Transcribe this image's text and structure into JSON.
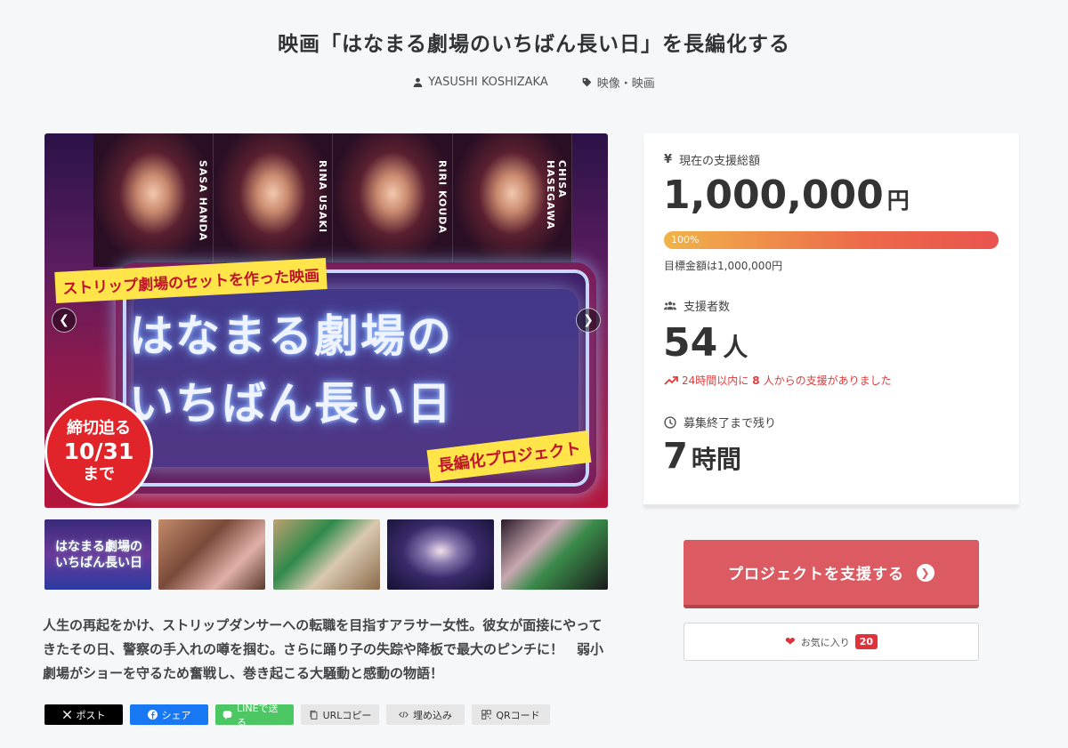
{
  "page": {
    "title": "映画「はなまる劇場のいちばん長い日」を長編化する",
    "author": "YASUSHI KOSHIZAKA",
    "category": "映像・映画"
  },
  "hero": {
    "cast": [
      "SASA HANDA",
      "RINA USAKI",
      "RIRI KOUDA",
      "CHISA HASEGAWA"
    ],
    "banner_top": "ストリップ劇場のセットを作った映画",
    "main_title_line1": "はなまる劇場の",
    "main_title_line2": "いちばん長い日",
    "banner_bottom": "長編化プロジェクト",
    "deadline_line1": "締切迫る",
    "deadline_line2": "10/31",
    "deadline_line3": "まで",
    "prev_icon": "chevron-left-icon",
    "next_icon": "chevron-right-icon"
  },
  "thumbnails": {
    "thumb0_title_line1": "はなまる劇場の",
    "thumb0_title_line2": "いちばん長い日"
  },
  "description": "人生の再起をかけ、ストリップダンサーへの転職を目指すアラサー女性。彼女が面接にやってきたその日、警察の手入れの噂を掴む。さらに踊り子の失踪や降板で最大のピンチに！　弱小劇場がショーを守るため奮戦し、巻き起こる大騒動と感動の物語！",
  "share": {
    "x": "ポスト",
    "facebook": "シェア",
    "line": "LINEで送る",
    "url_copy": "URLコピー",
    "embed": "埋め込み",
    "qr": "QRコード"
  },
  "stats": {
    "total_label": "現在の支援総額",
    "total_amount": "1,000,000",
    "total_unit": "円",
    "progress_text": "100%",
    "progress_value": 1.0,
    "goal_text": "目標金額は1,000,000円",
    "backers_label": "支援者数",
    "backers_count": "54",
    "backers_unit": "人",
    "recent_prefix": "24時間以内に",
    "recent_num": "8",
    "recent_suffix": "人からの支援がありました",
    "remaining_label": "募集終了まで残り",
    "remaining_value": "7",
    "remaining_unit": "時間"
  },
  "actions": {
    "support_label": "プロジェクトを支援する",
    "favorite_label": "お気に入り",
    "favorite_count": "20"
  },
  "colors": {
    "accent": "#dc5b63",
    "progress_start": "#f1b34a",
    "progress_end": "#e9544e",
    "recent_text": "#e23b3b"
  }
}
